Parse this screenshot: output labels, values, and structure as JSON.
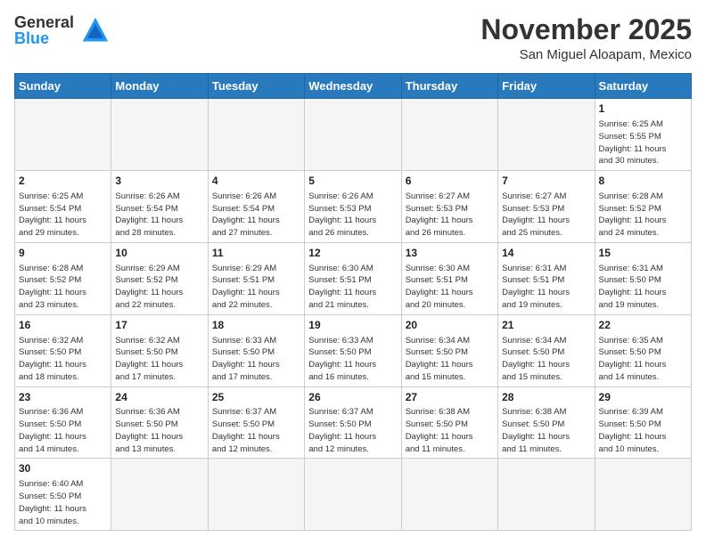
{
  "header": {
    "logo_general": "General",
    "logo_blue": "Blue",
    "month_title": "November 2025",
    "location": "San Miguel Aloapam, Mexico"
  },
  "days_of_week": [
    "Sunday",
    "Monday",
    "Tuesday",
    "Wednesday",
    "Thursday",
    "Friday",
    "Saturday"
  ],
  "weeks": [
    [
      {
        "day": "",
        "info": ""
      },
      {
        "day": "",
        "info": ""
      },
      {
        "day": "",
        "info": ""
      },
      {
        "day": "",
        "info": ""
      },
      {
        "day": "",
        "info": ""
      },
      {
        "day": "",
        "info": ""
      },
      {
        "day": "1",
        "info": "Sunrise: 6:25 AM\nSunset: 5:55 PM\nDaylight: 11 hours\nand 30 minutes."
      }
    ],
    [
      {
        "day": "2",
        "info": "Sunrise: 6:25 AM\nSunset: 5:54 PM\nDaylight: 11 hours\nand 29 minutes."
      },
      {
        "day": "3",
        "info": "Sunrise: 6:26 AM\nSunset: 5:54 PM\nDaylight: 11 hours\nand 28 minutes."
      },
      {
        "day": "4",
        "info": "Sunrise: 6:26 AM\nSunset: 5:54 PM\nDaylight: 11 hours\nand 27 minutes."
      },
      {
        "day": "5",
        "info": "Sunrise: 6:26 AM\nSunset: 5:53 PM\nDaylight: 11 hours\nand 26 minutes."
      },
      {
        "day": "6",
        "info": "Sunrise: 6:27 AM\nSunset: 5:53 PM\nDaylight: 11 hours\nand 26 minutes."
      },
      {
        "day": "7",
        "info": "Sunrise: 6:27 AM\nSunset: 5:53 PM\nDaylight: 11 hours\nand 25 minutes."
      },
      {
        "day": "8",
        "info": "Sunrise: 6:28 AM\nSunset: 5:52 PM\nDaylight: 11 hours\nand 24 minutes."
      }
    ],
    [
      {
        "day": "9",
        "info": "Sunrise: 6:28 AM\nSunset: 5:52 PM\nDaylight: 11 hours\nand 23 minutes."
      },
      {
        "day": "10",
        "info": "Sunrise: 6:29 AM\nSunset: 5:52 PM\nDaylight: 11 hours\nand 22 minutes."
      },
      {
        "day": "11",
        "info": "Sunrise: 6:29 AM\nSunset: 5:51 PM\nDaylight: 11 hours\nand 22 minutes."
      },
      {
        "day": "12",
        "info": "Sunrise: 6:30 AM\nSunset: 5:51 PM\nDaylight: 11 hours\nand 21 minutes."
      },
      {
        "day": "13",
        "info": "Sunrise: 6:30 AM\nSunset: 5:51 PM\nDaylight: 11 hours\nand 20 minutes."
      },
      {
        "day": "14",
        "info": "Sunrise: 6:31 AM\nSunset: 5:51 PM\nDaylight: 11 hours\nand 19 minutes."
      },
      {
        "day": "15",
        "info": "Sunrise: 6:31 AM\nSunset: 5:50 PM\nDaylight: 11 hours\nand 19 minutes."
      }
    ],
    [
      {
        "day": "16",
        "info": "Sunrise: 6:32 AM\nSunset: 5:50 PM\nDaylight: 11 hours\nand 18 minutes."
      },
      {
        "day": "17",
        "info": "Sunrise: 6:32 AM\nSunset: 5:50 PM\nDaylight: 11 hours\nand 17 minutes."
      },
      {
        "day": "18",
        "info": "Sunrise: 6:33 AM\nSunset: 5:50 PM\nDaylight: 11 hours\nand 17 minutes."
      },
      {
        "day": "19",
        "info": "Sunrise: 6:33 AM\nSunset: 5:50 PM\nDaylight: 11 hours\nand 16 minutes."
      },
      {
        "day": "20",
        "info": "Sunrise: 6:34 AM\nSunset: 5:50 PM\nDaylight: 11 hours\nand 15 minutes."
      },
      {
        "day": "21",
        "info": "Sunrise: 6:34 AM\nSunset: 5:50 PM\nDaylight: 11 hours\nand 15 minutes."
      },
      {
        "day": "22",
        "info": "Sunrise: 6:35 AM\nSunset: 5:50 PM\nDaylight: 11 hours\nand 14 minutes."
      }
    ],
    [
      {
        "day": "23",
        "info": "Sunrise: 6:36 AM\nSunset: 5:50 PM\nDaylight: 11 hours\nand 14 minutes."
      },
      {
        "day": "24",
        "info": "Sunrise: 6:36 AM\nSunset: 5:50 PM\nDaylight: 11 hours\nand 13 minutes."
      },
      {
        "day": "25",
        "info": "Sunrise: 6:37 AM\nSunset: 5:50 PM\nDaylight: 11 hours\nand 12 minutes."
      },
      {
        "day": "26",
        "info": "Sunrise: 6:37 AM\nSunset: 5:50 PM\nDaylight: 11 hours\nand 12 minutes."
      },
      {
        "day": "27",
        "info": "Sunrise: 6:38 AM\nSunset: 5:50 PM\nDaylight: 11 hours\nand 11 minutes."
      },
      {
        "day": "28",
        "info": "Sunrise: 6:38 AM\nSunset: 5:50 PM\nDaylight: 11 hours\nand 11 minutes."
      },
      {
        "day": "29",
        "info": "Sunrise: 6:39 AM\nSunset: 5:50 PM\nDaylight: 11 hours\nand 10 minutes."
      }
    ],
    [
      {
        "day": "30",
        "info": "Sunrise: 6:40 AM\nSunset: 5:50 PM\nDaylight: 11 hours\nand 10 minutes."
      },
      {
        "day": "",
        "info": ""
      },
      {
        "day": "",
        "info": ""
      },
      {
        "day": "",
        "info": ""
      },
      {
        "day": "",
        "info": ""
      },
      {
        "day": "",
        "info": ""
      },
      {
        "day": "",
        "info": ""
      }
    ]
  ]
}
